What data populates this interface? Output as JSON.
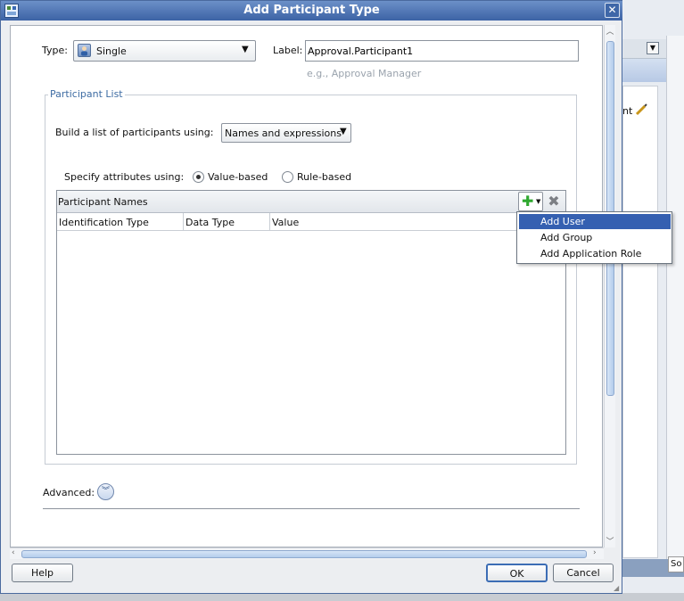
{
  "dialog": {
    "title": "Add Participant Type",
    "close_glyph": "✕"
  },
  "form": {
    "type_label": "Type:",
    "type_value": "Single",
    "label_label": "Label:",
    "label_value": "Approval.Participant1",
    "label_hint": "e.g., Approval Manager"
  },
  "participant_list": {
    "legend": "Participant List",
    "build_label": "Build a list of participants using:",
    "build_value": "Names and expressions",
    "specify_label": "Specify attributes using:",
    "radio_value_based": "Value-based",
    "radio_rule_based": "Rule-based",
    "selected_radio": "Value-based",
    "table": {
      "title": "Participant Names",
      "columns": [
        "Identification Type",
        "Data Type",
        "Value"
      ],
      "rows": []
    }
  },
  "add_menu": {
    "items": [
      "Add User",
      "Add Group",
      "Add Application Role"
    ],
    "highlighted": "Add User"
  },
  "advanced": {
    "label": "Advanced:"
  },
  "footer": {
    "help": "Help",
    "ok": "OK",
    "cancel": "Cancel"
  },
  "background_window": {
    "peek_text": "nt",
    "bottom_text": "So"
  },
  "colors": {
    "title_bar": "#3c63a5",
    "menu_highlight": "#3560b1",
    "legend": "#3e6ca3",
    "add_icon": "#2fa82f"
  }
}
